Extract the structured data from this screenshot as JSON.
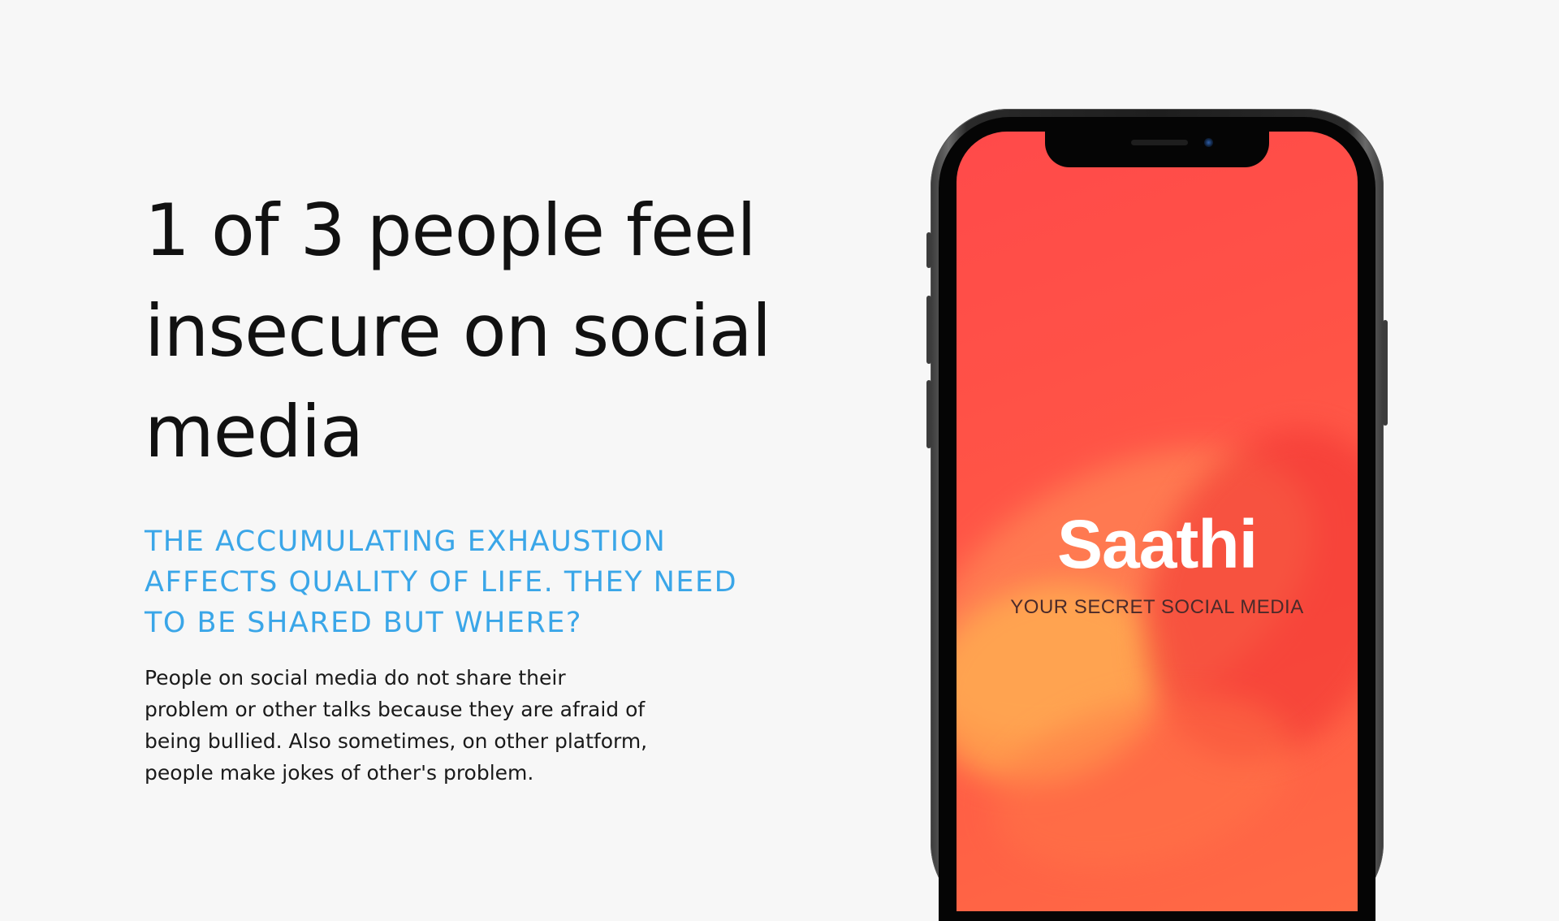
{
  "slide": {
    "headline": "1 of 3 people feel insecure on social media",
    "subheading": "THE ACCUMULATING EXHAUSTION AFFECTS QUALITY OF LIFE. THEY NEED TO BE SHARED BUT WHERE?",
    "body": "People on social media do not share their problem or other talks because they are afraid of being bullied. Also sometimes, on other platform, people make jokes of other's problem."
  },
  "phone_screen": {
    "app_name": "Saathi",
    "tagline": "YOUR SECRET SOCIAL MEDIA"
  },
  "colors": {
    "background": "#f7f7f7",
    "headline": "#111111",
    "subheading_accent": "#3aa6e8",
    "screen_red": "#ff5147",
    "phone_frame": "#1e1e1e"
  }
}
